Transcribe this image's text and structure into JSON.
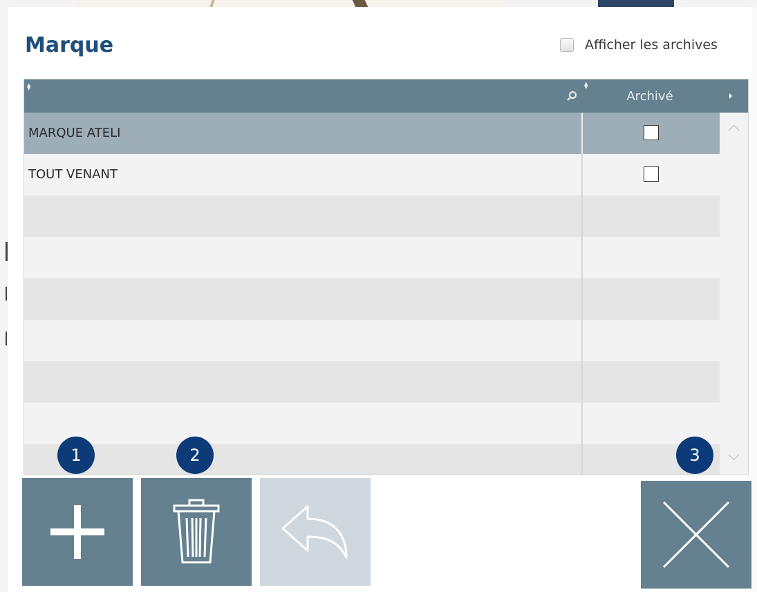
{
  "dialog": {
    "title": "Marque",
    "show_archives_label": "Afficher les archives",
    "show_archives_checked": false
  },
  "grid": {
    "columns": [
      {
        "label": "",
        "sortable": true,
        "searchable": true
      },
      {
        "label": "Archivé",
        "sortable": true
      }
    ],
    "rows": [
      {
        "name": "MARQUE ATELI",
        "archived": false,
        "selected": true
      },
      {
        "name": "TOUT VENANT",
        "archived": false,
        "selected": false
      },
      {
        "name": "",
        "archived": null
      },
      {
        "name": "",
        "archived": null
      },
      {
        "name": "",
        "archived": null
      },
      {
        "name": "",
        "archived": null
      },
      {
        "name": "",
        "archived": null
      },
      {
        "name": "",
        "archived": null
      },
      {
        "name": "",
        "archived": null
      }
    ]
  },
  "toolbar": {
    "add_icon": "plus-icon",
    "delete_icon": "trash-icon",
    "undo_icon": "undo-arrow-icon",
    "undo_enabled": false,
    "close_icon": "close-x-icon"
  },
  "badges": {
    "one": "1",
    "two": "2",
    "three": "3"
  },
  "colors": {
    "title": "#1e4f7a",
    "header": "#65808f",
    "selected_row": "#9eaeb8",
    "button": "#65808f",
    "button_disabled": "#cfd8de",
    "badge": "#0d3b7a"
  }
}
